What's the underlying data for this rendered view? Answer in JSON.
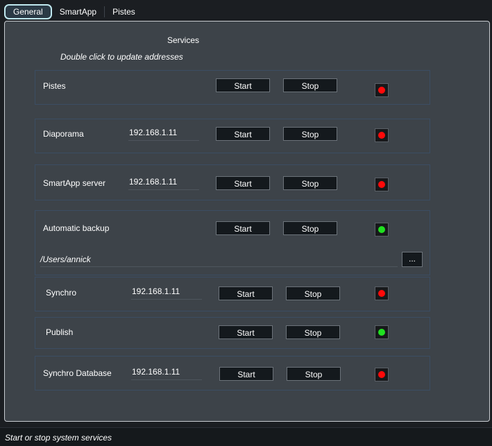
{
  "tabs": [
    "General",
    "SmartApp",
    "Pistes"
  ],
  "panel": {
    "title": "Services",
    "hint": "Double click to update addresses"
  },
  "colors": {
    "running": "#20e020",
    "stopped": "#ff0a0a"
  },
  "services": [
    {
      "name": "Pistes",
      "address": "",
      "start_label": "Start",
      "stop_label": "Stop",
      "status": "stopped"
    },
    {
      "name": "Diaporama",
      "address": "192.168.1.11",
      "start_label": "Start",
      "stop_label": "Stop",
      "status": "stopped"
    },
    {
      "name": "SmartApp server",
      "address": "192.168.1.11",
      "start_label": "Start",
      "stop_label": "Stop",
      "status": "stopped"
    },
    {
      "name": "Automatic backup",
      "address": "",
      "start_label": "Start",
      "stop_label": "Stop",
      "status": "running",
      "path": "/Users/annick",
      "browse_label": "..."
    },
    {
      "name": "Synchro",
      "address": "192.168.1.11",
      "start_label": "Start",
      "stop_label": "Stop",
      "status": "stopped"
    },
    {
      "name": "Publish",
      "address": "",
      "start_label": "Start",
      "stop_label": "Stop",
      "status": "running"
    },
    {
      "name": "Synchro Database",
      "address": "192.168.1.11",
      "start_label": "Start",
      "stop_label": "Stop",
      "status": "stopped"
    }
  ],
  "status_bar": "Start or stop system services"
}
